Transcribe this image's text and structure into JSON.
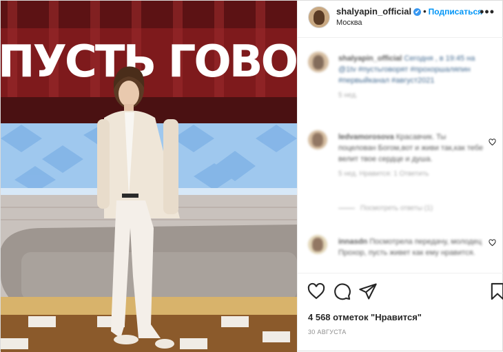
{
  "header": {
    "username": "shalyapin_official",
    "verified_mark": "✔",
    "separator": "•",
    "follow_label": "Подписаться",
    "location": "Москва",
    "more_icon": "more-dots-icon",
    "more_glyph": "•••"
  },
  "photo": {
    "studio_text": "ПУСТЬ ГОВОРЯТ"
  },
  "caption": {
    "username": "shalyapin_official",
    "text": "Сегодня , в 19:45 на @1tv #пустьговорят #прохоршаляпин #первыйканал #август2021",
    "time": "5 нед."
  },
  "comments": [
    {
      "username": "ledvamorosova",
      "text": "Красавчик. Ты поцелован Богом,вот и живи так,как тебе велит твое сердце и душа.",
      "meta": "5 нед.   Нравится: 1   Ответить",
      "replies": "Посмотреть ответы (1)"
    },
    {
      "username": "innasdn",
      "text": "Посмотрела передачу, молодец Прохор, пусть живет как ему нравится.",
      "meta": ""
    }
  ],
  "actions": {
    "like_icon": "heart-icon",
    "comment_icon": "comment-icon",
    "share_icon": "share-icon",
    "save_icon": "bookmark-icon",
    "likes_text": "4 568 отметок \"Нравится\"",
    "date": "30 АВГУСТА"
  }
}
